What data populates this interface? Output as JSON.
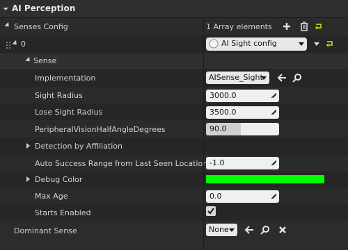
{
  "header": {
    "title": "AI Perception"
  },
  "senses_config": {
    "label": "Senses Config",
    "summary": "1 Array elements"
  },
  "element0": {
    "index": "0",
    "selected": "AI Sight config"
  },
  "sense": {
    "label": "Sense"
  },
  "implementation": {
    "label": "Implementation",
    "value": "AISense_Sight"
  },
  "sight_radius": {
    "label": "Sight Radius",
    "value": "3000.0"
  },
  "lose_sight_radius": {
    "label": "Lose Sight Radius",
    "value": "3500.0"
  },
  "peripheral": {
    "label": "PeripheralVisionHalfAngleDegrees",
    "value": "90.0",
    "fill_fraction": 0.48
  },
  "detection": {
    "label": "Detection by Affiliation"
  },
  "auto_success": {
    "label": "Auto Success Range from Last Seen Location",
    "value": "-1.0"
  },
  "debug_color": {
    "label": "Debug Color",
    "color": "#00ff00"
  },
  "max_age": {
    "label": "Max Age",
    "value": "0.0"
  },
  "starts_enabled": {
    "label": "Starts Enabled",
    "checked": true
  },
  "dominant_sense": {
    "label": "Dominant Sense",
    "value": "None"
  }
}
